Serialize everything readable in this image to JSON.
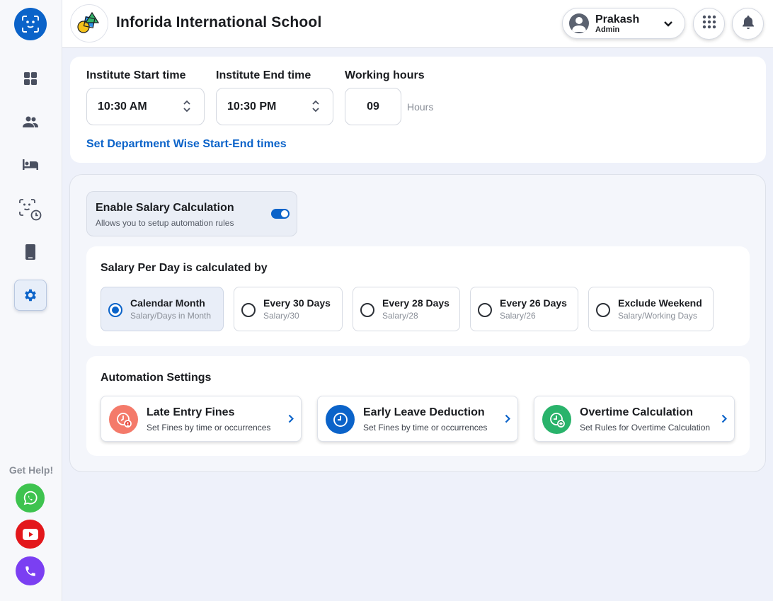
{
  "colors": {
    "primary": "#0b63c9",
    "late_entry": "#f47a6a",
    "early_leave": "#0b63c9",
    "overtime": "#29b36b",
    "whatsapp": "#3ec34f",
    "youtube": "#e3171b",
    "phone": "#7b3ff2"
  },
  "sidebar": {
    "logo_icon": "face-scan-icon",
    "items": [
      {
        "icon": "dashboard-icon",
        "active": false
      },
      {
        "icon": "users-icon",
        "active": false
      },
      {
        "icon": "bed-icon",
        "active": false
      },
      {
        "icon": "face-clock-icon",
        "active": false
      },
      {
        "icon": "mobile-icon",
        "active": false
      },
      {
        "icon": "settings-icon",
        "active": true
      }
    ],
    "help_label": "Get Help!",
    "help_buttons": [
      "whatsapp-icon",
      "youtube-icon",
      "phone-icon"
    ]
  },
  "header": {
    "school_name": "Inforida International School",
    "user_name": "Prakash",
    "user_role": "Admin"
  },
  "timing": {
    "start_label": "Institute Start time",
    "start_value": "10:30 AM",
    "end_label": "Institute End time",
    "end_value": "10:30 PM",
    "hours_label": "Working hours",
    "hours_value": "09",
    "hours_unit": "Hours",
    "dept_link": "Set Department Wise Start-End times"
  },
  "salary": {
    "toggle_title": "Enable Salary Calculation",
    "toggle_sub": "Allows you to setup automation rules",
    "toggle_on": true,
    "per_day_title": "Salary Per Day is calculated by",
    "options": [
      {
        "title": "Calendar Month",
        "sub": "Salary/Days in Month",
        "selected": true
      },
      {
        "title": "Every 30 Days",
        "sub": "Salary/30",
        "selected": false
      },
      {
        "title": "Every 28 Days",
        "sub": "Salary/28",
        "selected": false
      },
      {
        "title": "Every 26 Days",
        "sub": "Salary/26",
        "selected": false
      },
      {
        "title": "Exclude Weekend",
        "sub": "Salary/Working Days",
        "selected": false
      }
    ],
    "automation_title": "Automation Settings",
    "automation": [
      {
        "title": "Late Entry Fines",
        "sub": "Set Fines by time or occurrences",
        "icon": "late-clock-icon"
      },
      {
        "title": "Early Leave Deduction",
        "sub": "Set Fines by time or occurrences",
        "icon": "clock-icon"
      },
      {
        "title": "Overtime Calculation",
        "sub": "Set Rules for Overtime Calculation",
        "icon": "overtime-clock-icon"
      }
    ]
  }
}
